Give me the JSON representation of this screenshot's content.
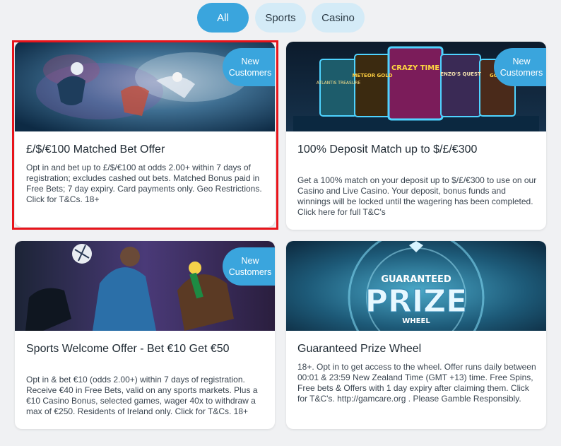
{
  "filters": {
    "all": "All",
    "sports": "Sports",
    "casino": "Casino",
    "active": "All"
  },
  "promos": [
    {
      "badge_line1": "New",
      "badge_line2": "Customers",
      "title": "£/$/€100 Matched Bet Offer",
      "description": "Opt in and bet up to £/$/€100 at odds 2.00+ within 7 days of registration; excludes cashed out bets. Matched Bonus paid in Free Bets; 7 day expiry. Card payments only. Geo Restrictions. Click for T&Cs. 18+",
      "selected": true
    },
    {
      "badge_line1": "New",
      "badge_line2": "Customers",
      "title": "100% Deposit Match up to $/£/€300",
      "description": "Get a 100% match on your deposit up to $/£/€300 to use on our Casino and Live Casino. Your deposit, bonus funds and winnings will be locked until the wagering has been completed. Click here for full T&C's",
      "selected": false,
      "banner_labels": [
        "ATLANTIS TREASURE",
        "METEOR GOLD",
        "CRAZY TIME",
        "ENZO'S QUEST",
        "GOLD"
      ]
    },
    {
      "badge_line1": "New",
      "badge_line2": "Customers",
      "title": "Sports Welcome Offer - Bet €10 Get €50",
      "description": "Opt in & bet €10 (odds 2.00+) within 7 days of registration. Receive €40 in Free Bets, valid on any sports markets. Plus a €10 Casino Bonus, selected games, wager 40x to withdraw a max of €250. Residents of Ireland only. Click for T&Cs. 18+",
      "selected": false
    },
    {
      "title": "Guaranteed Prize Wheel",
      "description": "18+. Opt in to get access to the wheel. Offer runs daily between 00:01 & 23:59 New Zealand Time (GMT +13) time. Free Spins, Free bets & Offers with 1 day expiry after claiming them. Click for T&C's. http://gamcare.org . Please Gamble Responsibly.",
      "selected": false,
      "banner_text_top": "GUARANTEED",
      "banner_text_main": "PRIZE",
      "banner_text_bottom": "WHEEL"
    }
  ],
  "colors": {
    "accent": "#3aa5dd",
    "tab_inactive": "#d4ebf7",
    "selection_outline": "#e8141b",
    "page_background": "#f0f1f3"
  }
}
